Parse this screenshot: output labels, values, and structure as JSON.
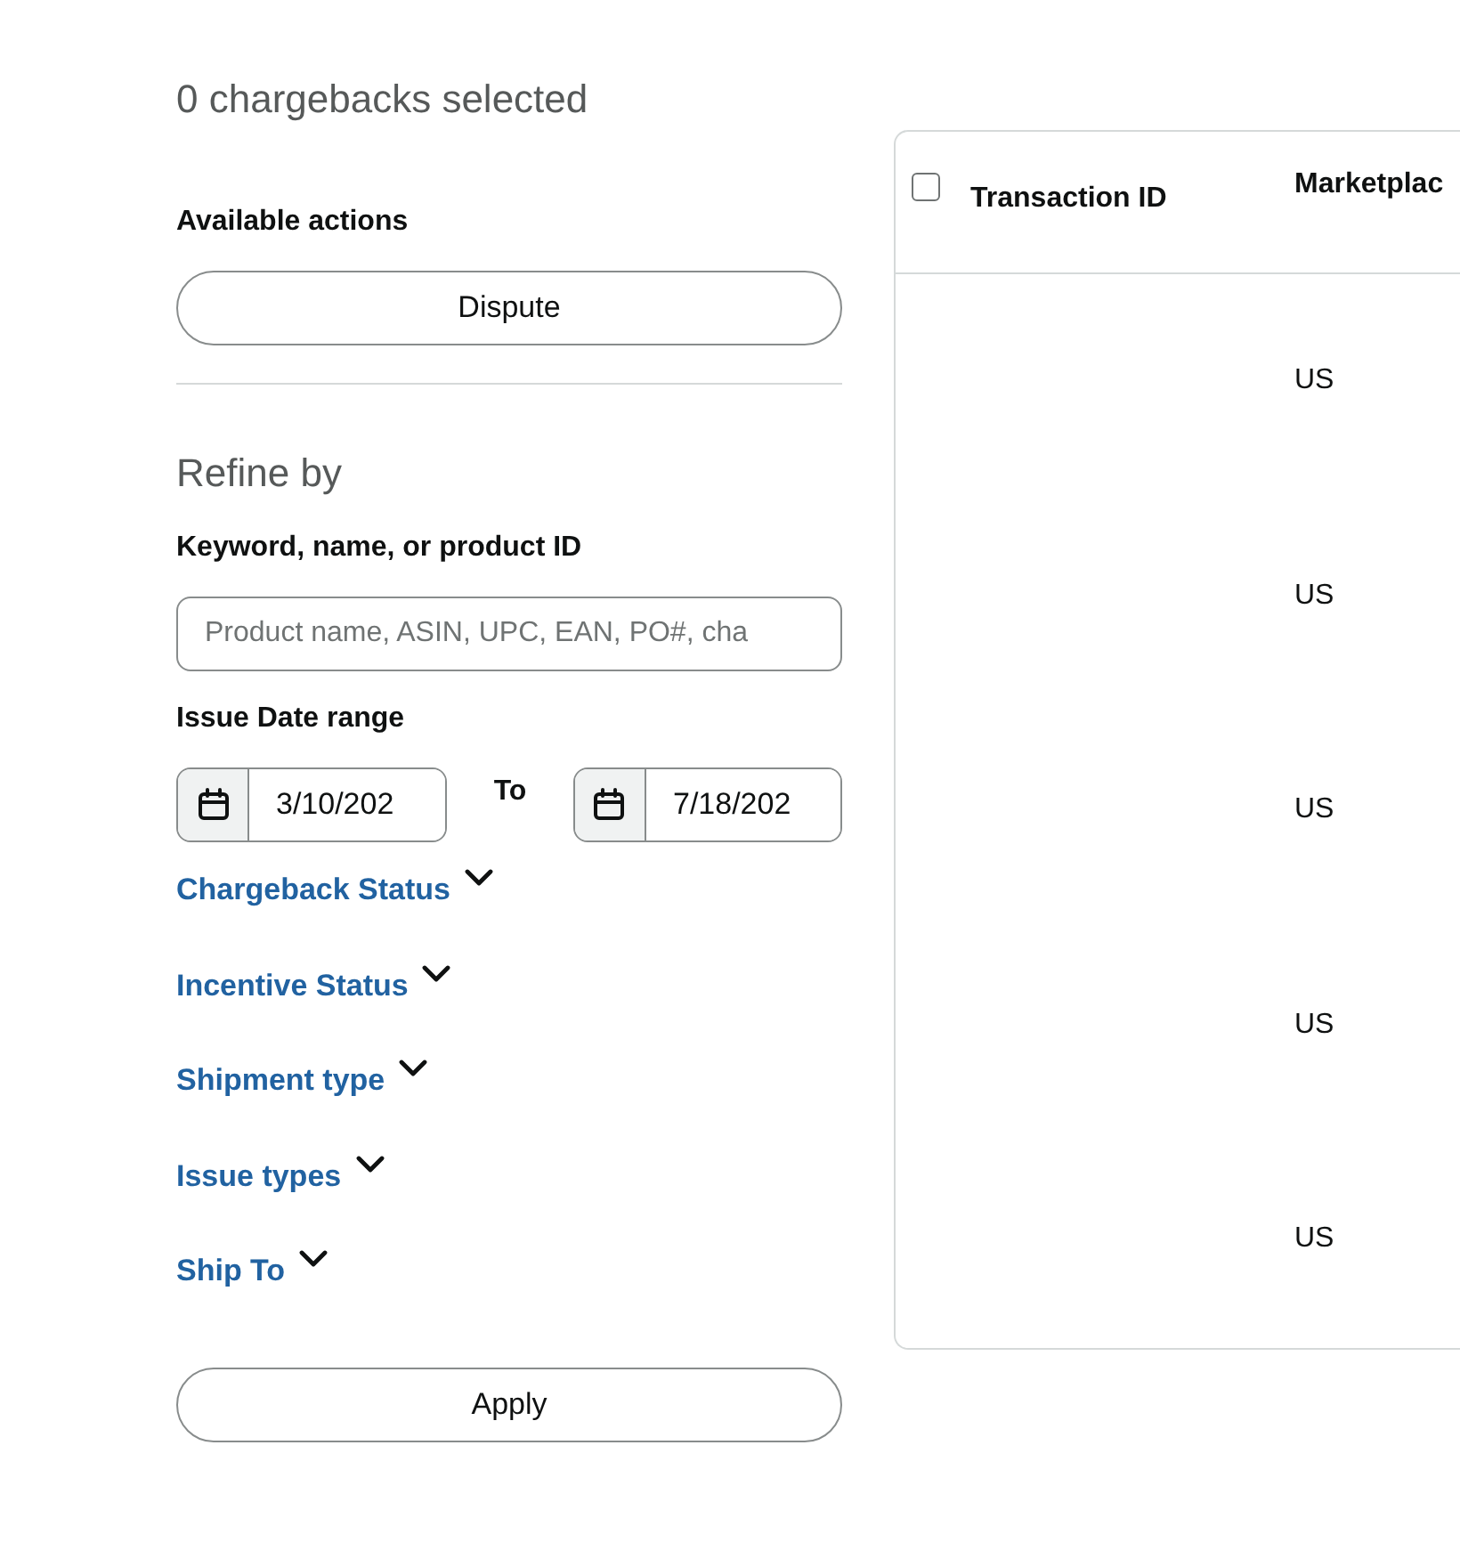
{
  "selection_summary": "0 chargebacks selected",
  "actions": {
    "title": "Available actions",
    "buttons": [
      "Dispute"
    ]
  },
  "refine": {
    "title": "Refine by",
    "keyword": {
      "label": "Keyword, name, or product ID",
      "placeholder": "Product name, ASIN, UPC, EAN, PO#, cha"
    },
    "date_range": {
      "label": "Issue Date range",
      "from": "3/10/202",
      "separator": "To",
      "to": "7/18/202"
    },
    "filters": [
      {
        "label": "Chargeback Status",
        "expanded": false
      },
      {
        "label": "Incentive Status",
        "expanded": false
      },
      {
        "label": "Shipment type",
        "expanded": false
      },
      {
        "label": "Issue types",
        "expanded": false
      },
      {
        "label": "Ship To",
        "expanded": false
      }
    ],
    "apply_button": "Apply"
  },
  "table": {
    "select_all": {
      "checked": false
    },
    "columns": [
      "Transaction ID",
      "Marketplac"
    ],
    "rows": [
      {
        "marketplace": "US"
      },
      {
        "marketplace": "US"
      },
      {
        "marketplace": "US"
      },
      {
        "marketplace": "US"
      },
      {
        "marketplace": "US"
      }
    ]
  }
}
